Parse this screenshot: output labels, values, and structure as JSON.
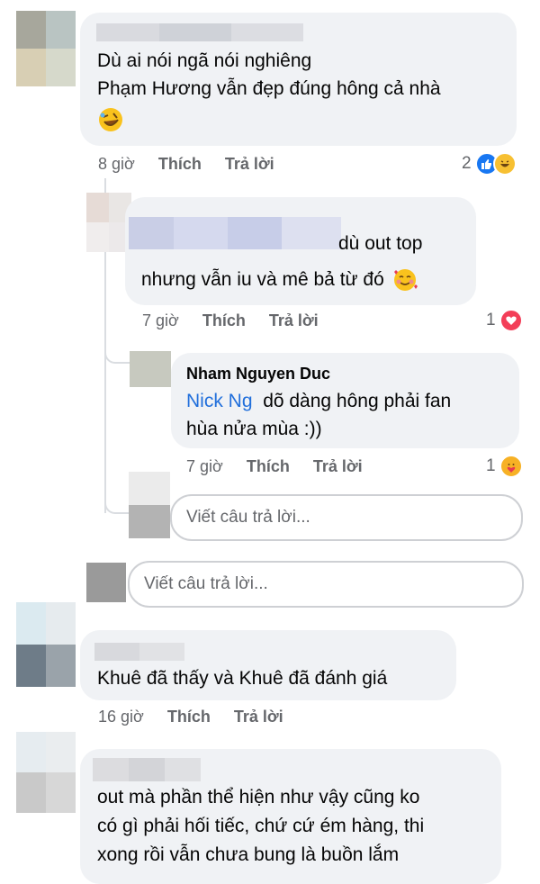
{
  "comments": [
    {
      "id": "c1",
      "lines": [
        "Dù ai nói ngã nói nghiêng",
        "Phạm Hương vẫn đẹp đúng hông cả nhà"
      ],
      "emoji": "rolling-on-floor-laughing-emoji",
      "time": "8 giờ",
      "like_label": "Thích",
      "reply_label": "Trả lời",
      "reaction_count": "2",
      "reactions": [
        "like",
        "haha"
      ]
    },
    {
      "id": "c1r1",
      "line1": "dù out top",
      "line2": "nhưng vẫn iu và mê bả từ đó",
      "emoji": "smiling-face-with-hearts-emoji",
      "time": "7 giờ",
      "like_label": "Thích",
      "reply_label": "Trả lời",
      "reaction_count": "1",
      "reactions": [
        "love"
      ]
    },
    {
      "id": "c1r2",
      "author": "Nham Nguyen Duc",
      "mention": "Nick Ng",
      "line1": "dõ dàng hông phải fan",
      "line2": "hùa nửa mùa :))",
      "time": "7 giờ",
      "like_label": "Thích",
      "reply_label": "Trả lời",
      "reaction_count": "1",
      "reactions": [
        "care"
      ]
    },
    {
      "id": "c2",
      "text": "Khuê đã thấy và Khuê đã đánh giá",
      "time": "16 giờ",
      "like_label": "Thích",
      "reply_label": "Trả lời"
    },
    {
      "id": "c3",
      "lines": [
        "out mà phần thể hiện như  vậy cũng ko",
        "có gì phải hối tiếc, chứ cứ ém hàng, thi",
        "xong rồi vẫn chưa bung là buồn lắm"
      ]
    }
  ],
  "reply_inputs": {
    "nested_placeholder": "Viết câu trả lời...",
    "thread_placeholder": "Viết câu trả lời..."
  },
  "colors": {
    "bubble": "#f0f2f5",
    "meta_text": "#65676b",
    "mention": "#216fdb",
    "like_blue": "#1877f2",
    "love_red": "#f33e58"
  }
}
